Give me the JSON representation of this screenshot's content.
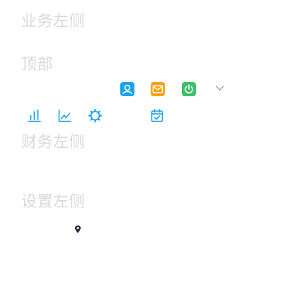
{
  "sections": {
    "business_left": {
      "title": "业务左侧"
    },
    "top": {
      "title": "顶部"
    },
    "finance_left": {
      "title": "财务左侧"
    },
    "settings_left": {
      "title": "设置左侧"
    }
  },
  "top_icons": [
    {
      "name": "user-icon",
      "color": "#1aa3e8"
    },
    {
      "name": "mail-icon",
      "color": "#ff9f0a"
    },
    {
      "name": "power-icon",
      "color": "#3cc06a"
    },
    {
      "name": "chevron-down-icon",
      "color": "#8c8c8c"
    }
  ],
  "business_icons": [
    {
      "name": "bar-chart-icon",
      "color": "#1aa3e8"
    },
    {
      "name": "line-chart-icon",
      "color": "#1aa3e8"
    },
    {
      "name": "gear-icon",
      "color": "#1aa3e8"
    },
    {
      "name": "calendar-check-icon",
      "color": "#1aa3e8"
    }
  ],
  "settings_icons": [
    {
      "name": "location-pin-icon",
      "color": "#1f2d3d"
    }
  ]
}
